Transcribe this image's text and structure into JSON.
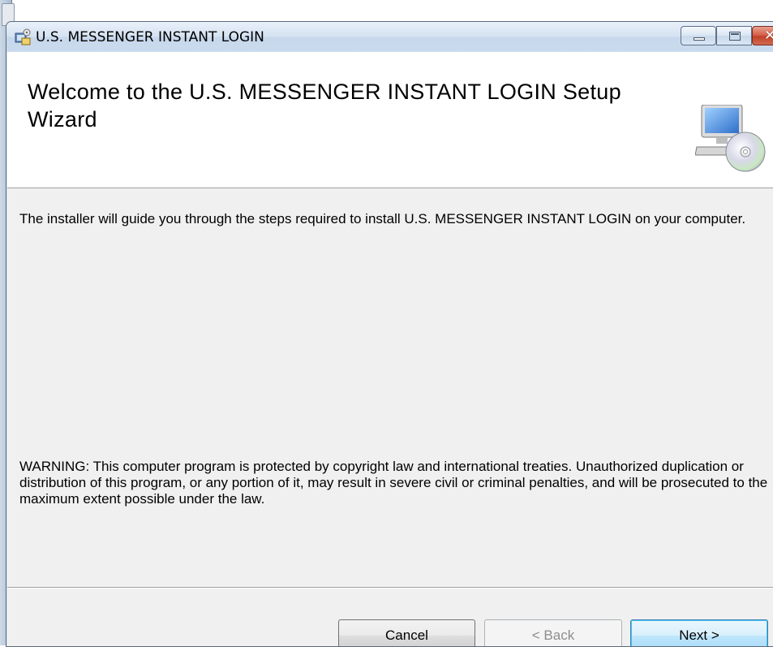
{
  "window": {
    "title": "U.S. MESSENGER INSTANT LOGIN",
    "controls": {
      "minimize": "minimize",
      "maximize": "maximize",
      "close": "✕"
    }
  },
  "banner": {
    "title": "Welcome to the U.S. MESSENGER INSTANT LOGIN Setup Wizard",
    "icon": "computer-cd-icon"
  },
  "content": {
    "intro": "The installer will guide you through the steps required to install U.S. MESSENGER INSTANT LOGIN on your computer.",
    "warning": "WARNING: This computer program is protected by copyright law and international treaties. Unauthorized duplication or distribution of this program, or any portion of it, may result in severe civil or criminal penalties, and will be prosecuted to the maximum extent possible under the law."
  },
  "buttons": {
    "cancel": "Cancel",
    "back": "< Back",
    "next": "Next >"
  },
  "colors": {
    "body_bg": "#f0f0f0",
    "banner_bg": "#ffffff",
    "next_border": "#3c7fb1",
    "close_red": "#c2412a"
  }
}
